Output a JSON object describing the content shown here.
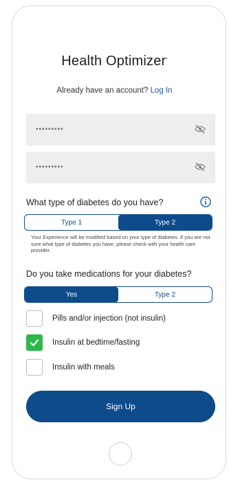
{
  "app": {
    "title": "Health Optimizer",
    "trademark": "•"
  },
  "login": {
    "prompt": "Already have an account?",
    "link": "Log In"
  },
  "fields": [
    {
      "masked_value": "•••••••••",
      "icon": "eye-slash-icon"
    },
    {
      "masked_value": "•••••••••",
      "icon": "eye-slash-icon"
    }
  ],
  "diabetes_type": {
    "question": "What type of diabetes do you have?",
    "info_icon": "info-icon",
    "options": [
      "Type 1",
      "Type 2"
    ],
    "selected": "Type 2",
    "note": "Your Experience will be modified based on your type of diabetes. If you are not sure what type of diabetes you have, please check with your health care provider."
  },
  "medications": {
    "question": "Do you take medications for your diabetes?",
    "options": [
      "Yes",
      "Type 2"
    ],
    "selected": "Yes",
    "checkboxes": [
      {
        "label": "Pills and/or injection (not insulin)",
        "checked": false
      },
      {
        "label": "Insulin at bedtime/fasting",
        "checked": true
      },
      {
        "label": "Insulin with meals",
        "checked": false
      }
    ]
  },
  "signup_button": "Sign Up",
  "colors": {
    "primary": "#0d4b8b",
    "link": "#1a5aa6",
    "check": "#2db84b",
    "field_bg": "#eeeeef"
  }
}
